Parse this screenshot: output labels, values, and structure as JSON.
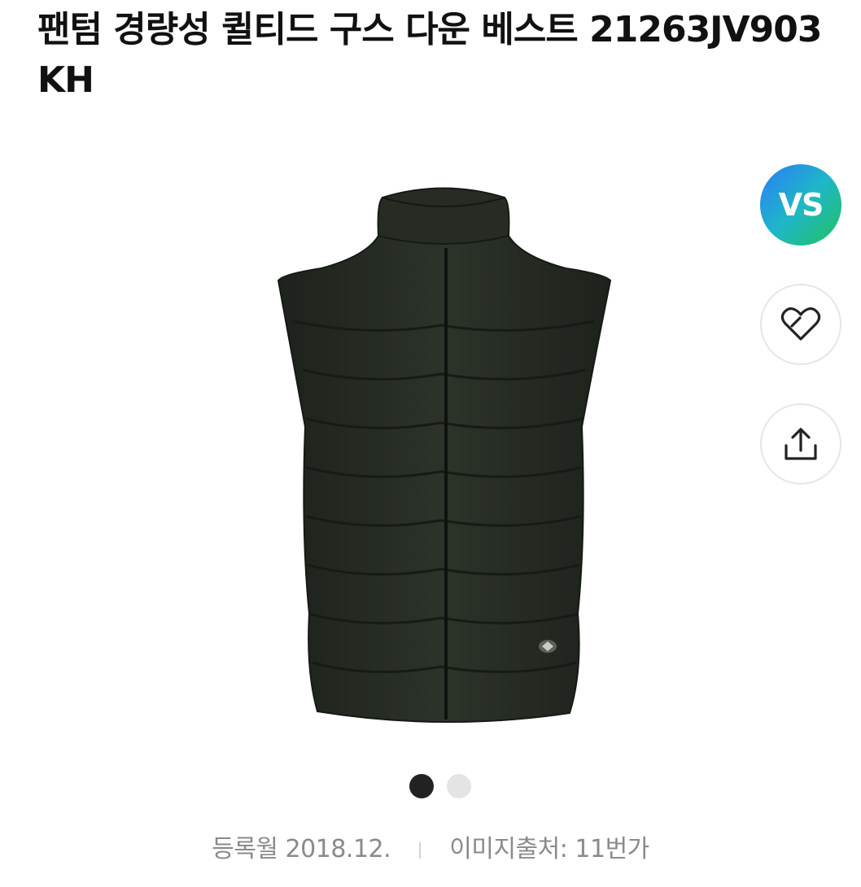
{
  "product": {
    "title": "팬텀 경량성 퀼티드 구스 다운 베스트 21263JV903 KH"
  },
  "actions": {
    "vs_label": "VS",
    "like_icon": "heart-outline-icon",
    "share_icon": "share-upload-icon"
  },
  "gallery": {
    "current_index": 1,
    "total": 2
  },
  "meta": {
    "registered": "등록월 2018.12.",
    "source": "이미지출처: 11번가"
  },
  "colors": {
    "vest": "#262c24",
    "vs_gradient_start": "#2a7cf6",
    "vs_gradient_end": "#21c25b",
    "dot_active": "#222222",
    "dot_inactive": "#e4e4e4",
    "meta_text": "#8a8a8a"
  }
}
